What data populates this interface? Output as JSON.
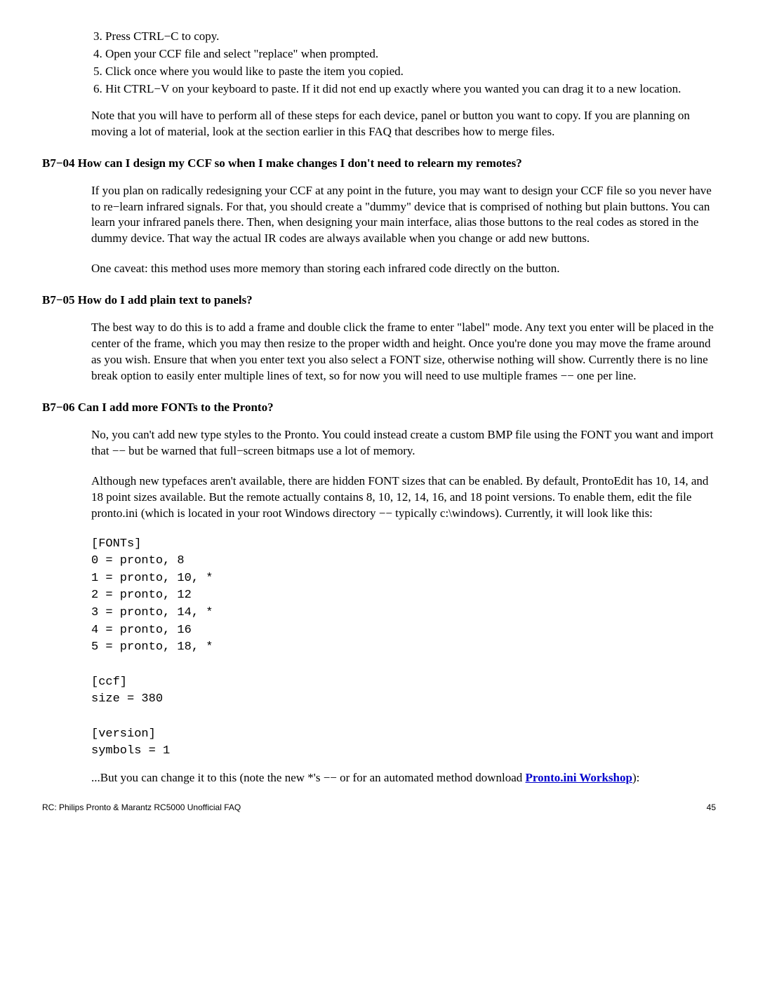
{
  "steps": {
    "start": "3",
    "items": [
      "Press CTRL−C to copy.",
      "Open your CCF file and select \"replace\" when prompted.",
      "Click once where you would like to paste the item you copied.",
      "Hit CTRL−V on your keyboard to paste. If it did not end up exactly where you wanted you can drag it to a new location."
    ]
  },
  "after_steps_para": "Note that you will have to perform all of these steps for each device, panel or button you want to copy. If you are planning on moving a lot of material, look at the section earlier in this FAQ that describes how to merge files.",
  "s1": {
    "heading": "B7−04   How can I design my CCF so when I make changes I don't need to relearn my remotes?",
    "p1": "If you plan on radically redesigning your CCF at any point in the future, you may want to design your CCF file so you never have to re−learn infrared signals. For that, you should create a \"dummy\" device that is comprised of nothing but plain buttons. You can learn your infrared panels there. Then, when designing your main interface, alias those buttons to the real codes as stored in the dummy device. That way the actual IR codes are always available when you change or add new buttons.",
    "p2": "One caveat: this method uses more memory than storing each infrared code directly on the button."
  },
  "s2": {
    "heading": "B7−05   How do I add plain text to panels?",
    "p1": "The best way to do this is to add a frame and double click the frame to enter \"label\" mode. Any text you enter will be placed in the center of the frame, which you may then resize to the proper width and height. Once you're done you may move the frame around as you wish. Ensure that when you enter text you also select a FONT size, otherwise nothing will show. Currently there is no line break option to easily enter multiple lines of text, so for now you will need to use multiple frames −− one per line."
  },
  "s3": {
    "heading": "B7−06   Can I add more FONTs to the Pronto?",
    "p1": "No, you can't add new type styles to the Pronto. You could instead create a custom BMP file using the FONT you want and import that −− but be warned that full−screen bitmaps use a lot of memory.",
    "p2": "Although new typefaces aren't available, there are hidden FONT sizes that can be enabled. By default, ProntoEdit has 10, 14, and 18 point sizes available. But the remote actually contains 8, 10, 12, 14, 16, and 18 point versions. To enable them, edit the file pronto.ini (which is located in your root Windows directory −− typically c:\\windows). Currently, it will look like this:",
    "code": "[FONTs]\n0 = pronto, 8\n1 = pronto, 10, *\n2 = pronto, 12\n3 = pronto, 14, *\n4 = pronto, 16\n5 = pronto, 18, *\n\n[ccf]\nsize = 380\n\n[version]\nsymbols = 1",
    "p3_before": "...But you can change it to this (note the new *'s −− or for an automated method download ",
    "p3_link": "Pronto.ini Workshop",
    "p3_after": "):"
  },
  "footer": {
    "left": "RC: Philips Pronto & Marantz RC5000 Unofficial FAQ",
    "right": "45"
  }
}
